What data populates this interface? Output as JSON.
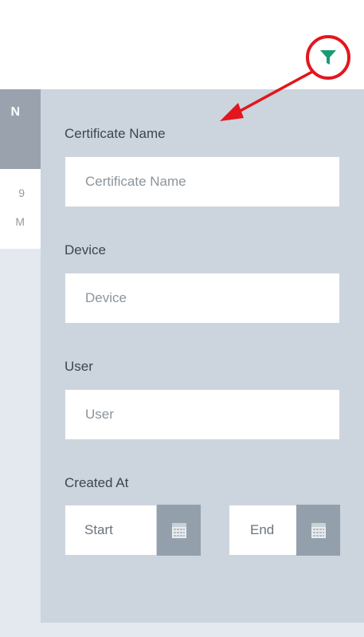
{
  "table": {
    "header_fragment": "N",
    "row_fragment_line1": "9",
    "row_fragment_line2": "M"
  },
  "filter": {
    "icon": "funnel-icon",
    "icon_color": "#1a9a76",
    "highlight_color": "#e3161d"
  },
  "form": {
    "certificate_name": {
      "label": "Certificate Name",
      "placeholder": "Certificate Name"
    },
    "device": {
      "label": "Device",
      "placeholder": "Device"
    },
    "user": {
      "label": "User",
      "placeholder": "User"
    },
    "created_at": {
      "label": "Created At",
      "start_placeholder": "Start",
      "end_placeholder": "End",
      "calendar_icon": "calendar-icon"
    }
  },
  "colors": {
    "panel_bg": "#ccd4de",
    "calendar_button": "#93a0ab",
    "annotation": "#e3161d"
  }
}
